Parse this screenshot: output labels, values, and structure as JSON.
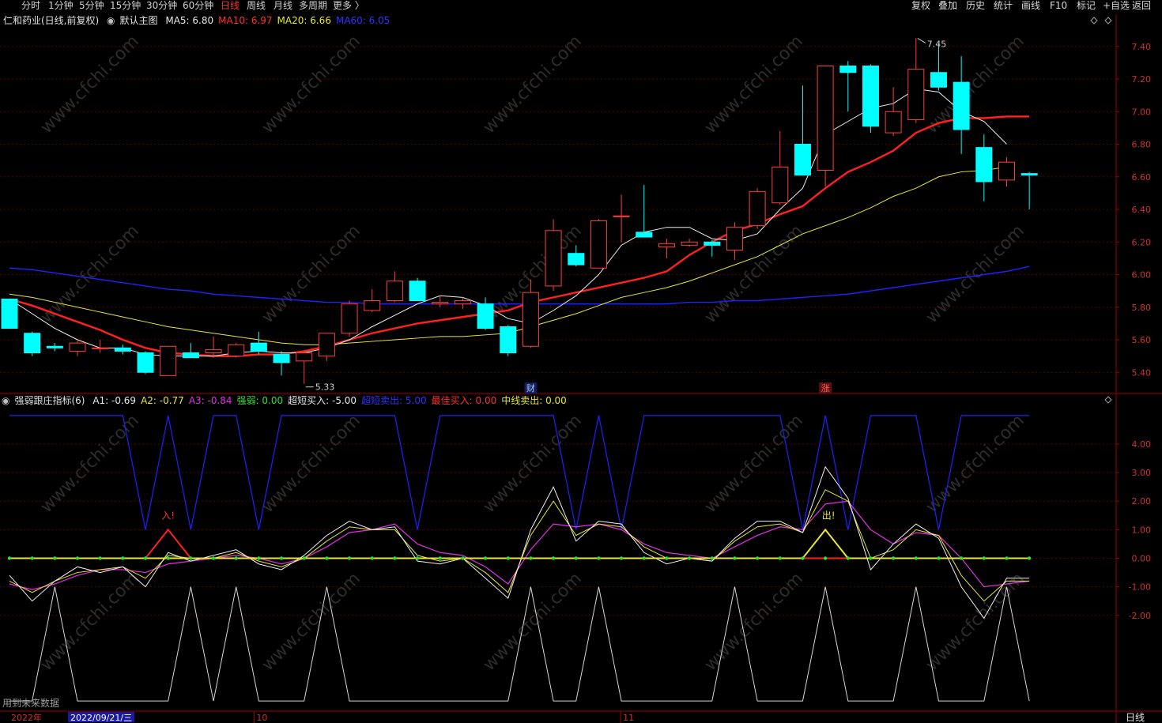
{
  "toolbar": {
    "tabs": [
      "分时",
      "1分钟",
      "5分钟",
      "15分钟",
      "30分钟",
      "60分钟",
      "日线",
      "周线",
      "月线",
      "多周期",
      "更多 〉"
    ],
    "active_tab": "日线",
    "right": [
      "复权",
      "叠加",
      "历史",
      "统计",
      "画线",
      "F10",
      "标记",
      "+自选",
      "返回"
    ]
  },
  "main_legend": {
    "stock": "仁和药业(日线,前复权)",
    "template": "默认主图",
    "items": [
      {
        "label": "MA5:",
        "value": "6.80",
        "color": "#e8e8e8"
      },
      {
        "label": "MA10:",
        "value": "6.97",
        "color": "#ff3030"
      },
      {
        "label": "MA20:",
        "value": "6.66",
        "color": "#e8e830"
      },
      {
        "label": "MA60:",
        "value": "6.05",
        "color": "#3030ff"
      }
    ]
  },
  "sub_legend": {
    "name": "强弱跟庄指标(6)",
    "items": [
      {
        "label": "A1:",
        "value": "-0.69",
        "color": "#e8e8e8"
      },
      {
        "label": "A2:",
        "value": "-0.77",
        "color": "#e8e830"
      },
      {
        "label": "A3:",
        "value": "-0.84",
        "color": "#e030e0"
      },
      {
        "label": "强弱:",
        "value": "0.00",
        "color": "#30e030"
      },
      {
        "label": "超短买入:",
        "value": "-5.00",
        "color": "#e8e8e8"
      },
      {
        "label": "超短卖出:",
        "value": "5.00",
        "color": "#3030ff"
      },
      {
        "label": "最佳买入:",
        "value": "0.00",
        "color": "#ff3030"
      },
      {
        "label": "中线卖出:",
        "value": "0.00",
        "color": "#e8e830"
      }
    ]
  },
  "colors": {
    "up": "#ff3d3d",
    "down": "#00ffff",
    "ma5": "#f0f0f0",
    "ma10": "#ff2020",
    "ma20": "#e8e830",
    "ma60": "#2020ff",
    "grid": "#5a0000",
    "border": "#a00000"
  },
  "annotations": {
    "high": "7.45",
    "low": "5.33",
    "cai_marker": "财",
    "zhang_marker": "涨",
    "buy_marker": "入!",
    "sell_marker": "出!",
    "watermark": "www.cfchi.com",
    "footer_note": "用到未来数据"
  },
  "bottom_axis": {
    "labels": [
      "2022年",
      "10",
      "11"
    ],
    "cursor_date": "2022/09/21/三",
    "period_label": "日线"
  },
  "chart_data": [
    {
      "type": "candlestick",
      "title": "仁和药业(日线,前复权)",
      "ylim": [
        5.28,
        7.52
      ],
      "yticks": [
        5.4,
        5.6,
        5.8,
        6.0,
        6.2,
        6.4,
        6.6,
        6.8,
        7.0,
        7.2,
        7.4
      ],
      "candles": [
        [
          5.85,
          5.82,
          5.67,
          5.67
        ],
        [
          5.64,
          5.65,
          5.5,
          5.52
        ],
        [
          5.56,
          5.58,
          5.53,
          5.55
        ],
        [
          5.53,
          5.6,
          5.5,
          5.58
        ],
        [
          5.55,
          5.6,
          5.52,
          5.55
        ],
        [
          5.55,
          5.57,
          5.51,
          5.53
        ],
        [
          5.52,
          5.53,
          5.39,
          5.4
        ],
        [
          5.38,
          5.56,
          5.38,
          5.56
        ],
        [
          5.52,
          5.58,
          5.5,
          5.49
        ],
        [
          5.52,
          5.62,
          5.49,
          5.54
        ],
        [
          5.5,
          5.58,
          5.49,
          5.57
        ],
        [
          5.58,
          5.65,
          5.51,
          5.53
        ],
        [
          5.51,
          5.53,
          5.38,
          5.46
        ],
        [
          5.47,
          5.53,
          5.33,
          5.52
        ],
        [
          5.5,
          5.64,
          5.47,
          5.64
        ],
        [
          5.64,
          5.84,
          5.62,
          5.82
        ],
        [
          5.78,
          5.91,
          5.77,
          5.84
        ],
        [
          5.84,
          6.02,
          5.83,
          5.96
        ],
        [
          5.96,
          5.98,
          5.84,
          5.84
        ],
        [
          5.82,
          5.87,
          5.8,
          5.83
        ],
        [
          5.82,
          5.86,
          5.79,
          5.84
        ],
        [
          5.82,
          5.86,
          5.66,
          5.67
        ],
        [
          5.68,
          5.69,
          5.5,
          5.52
        ],
        [
          5.56,
          5.97,
          5.55,
          5.89
        ],
        [
          5.93,
          6.34,
          5.9,
          6.27
        ],
        [
          6.13,
          6.18,
          6.05,
          6.06
        ],
        [
          6.04,
          6.34,
          6.04,
          6.33
        ],
        [
          6.36,
          6.49,
          6.2,
          6.36
        ],
        [
          6.26,
          6.55,
          6.25,
          6.23
        ],
        [
          6.17,
          6.22,
          6.1,
          6.19
        ],
        [
          6.18,
          6.22,
          6.17,
          6.2
        ],
        [
          6.2,
          6.21,
          6.11,
          6.18
        ],
        [
          6.15,
          6.32,
          6.09,
          6.29
        ],
        [
          6.3,
          6.53,
          6.28,
          6.51
        ],
        [
          6.44,
          6.88,
          6.43,
          6.66
        ],
        [
          6.8,
          7.16,
          6.62,
          6.61
        ],
        [
          6.64,
          7.28,
          6.54,
          7.28
        ],
        [
          7.28,
          7.31,
          7.0,
          7.24
        ],
        [
          7.28,
          7.29,
          6.87,
          6.91
        ],
        [
          6.87,
          7.15,
          6.85,
          7.0
        ],
        [
          6.95,
          7.45,
          6.93,
          7.26
        ],
        [
          7.24,
          7.42,
          7.13,
          7.15
        ],
        [
          7.18,
          7.34,
          6.74,
          6.89
        ],
        [
          6.78,
          6.86,
          6.45,
          6.57
        ],
        [
          6.58,
          6.72,
          6.54,
          6.69
        ],
        [
          6.62,
          6.63,
          6.4,
          6.61
        ]
      ],
      "ma5": [
        5.85,
        5.76,
        5.67,
        5.6,
        5.55,
        5.55,
        5.51,
        5.5,
        5.5,
        5.5,
        5.52,
        5.53,
        5.52,
        5.52,
        5.55,
        5.6,
        5.68,
        5.75,
        5.82,
        5.87,
        5.86,
        5.81,
        5.73,
        5.7,
        5.78,
        5.87,
        6.0,
        6.18,
        6.26,
        6.29,
        6.29,
        6.22,
        6.21,
        6.25,
        6.4,
        6.53,
        6.86,
        6.94,
        7.02,
        7.05,
        7.14,
        7.12,
        7.0,
        6.94,
        6.8
      ],
      "ma10": [
        5.85,
        5.81,
        5.76,
        5.71,
        5.66,
        5.6,
        5.55,
        5.52,
        5.51,
        5.5,
        5.5,
        5.51,
        5.51,
        5.53,
        5.56,
        5.6,
        5.64,
        5.67,
        5.7,
        5.72,
        5.74,
        5.76,
        5.78,
        5.83,
        5.86,
        5.89,
        5.92,
        5.95,
        5.98,
        6.02,
        6.12,
        6.2,
        6.27,
        6.31,
        6.37,
        6.42,
        6.53,
        6.63,
        6.69,
        6.76,
        6.87,
        6.93,
        6.96,
        6.96,
        6.97,
        6.97
      ],
      "ma20": [
        5.88,
        5.86,
        5.83,
        5.8,
        5.77,
        5.74,
        5.71,
        5.68,
        5.66,
        5.64,
        5.62,
        5.6,
        5.58,
        5.57,
        5.57,
        5.58,
        5.59,
        5.6,
        5.61,
        5.62,
        5.62,
        5.63,
        5.64,
        5.68,
        5.72,
        5.76,
        5.81,
        5.86,
        5.89,
        5.92,
        5.96,
        6.01,
        6.06,
        6.11,
        6.18,
        6.25,
        6.3,
        6.35,
        6.41,
        6.48,
        6.53,
        6.6,
        6.63,
        6.64,
        6.66
      ],
      "ma60": [
        6.04,
        6.03,
        6.01,
        5.99,
        5.97,
        5.95,
        5.93,
        5.91,
        5.9,
        5.88,
        5.87,
        5.86,
        5.85,
        5.84,
        5.83,
        5.83,
        5.82,
        5.82,
        5.82,
        5.82,
        5.82,
        5.82,
        5.82,
        5.82,
        5.82,
        5.82,
        5.82,
        5.82,
        5.82,
        5.82,
        5.83,
        5.83,
        5.84,
        5.84,
        5.85,
        5.86,
        5.87,
        5.88,
        5.9,
        5.92,
        5.94,
        5.96,
        5.98,
        6.0,
        6.02,
        6.05
      ]
    },
    {
      "type": "line",
      "title": "强弱跟庄指标(6)",
      "ylim": [
        -5.3,
        5.3
      ],
      "yticks": [
        -2.0,
        -1.0,
        0.0,
        1.0,
        2.0,
        3.0,
        4.0
      ],
      "series": [
        {
          "name": "A1",
          "values": [
            -0.6,
            -1.5,
            -0.8,
            -0.3,
            -0.5,
            -0.3,
            -1.0,
            0.2,
            -0.1,
            0.1,
            0.3,
            -0.2,
            -0.4,
            0.1,
            0.8,
            1.3,
            1.0,
            1.1,
            -0.1,
            -0.2,
            0.0,
            -0.7,
            -1.4,
            1.0,
            2.5,
            0.6,
            1.3,
            1.2,
            0.2,
            -0.2,
            0.0,
            -0.1,
            0.7,
            1.3,
            1.3,
            0.9,
            3.2,
            2.1,
            -0.4,
            0.5,
            1.2,
            0.7,
            -1.0,
            -2.1,
            -0.7,
            -0.7
          ]
        },
        {
          "name": "A2",
          "values": [
            -0.8,
            -1.2,
            -0.8,
            -0.5,
            -0.4,
            -0.3,
            -0.7,
            0.1,
            0.0,
            0.0,
            0.2,
            -0.1,
            -0.3,
            0.0,
            0.6,
            1.1,
            1.0,
            1.0,
            0.1,
            -0.1,
            0.0,
            -0.5,
            -1.2,
            0.8,
            2.0,
            0.8,
            1.2,
            1.1,
            0.4,
            0.0,
            0.0,
            -0.1,
            0.6,
            1.1,
            1.2,
            0.9,
            2.4,
            2.0,
            0.0,
            0.3,
            1.0,
            0.8,
            -0.6,
            -1.5,
            -0.8,
            -0.8
          ]
        },
        {
          "name": "A3",
          "values": [
            -0.9,
            -1.1,
            -0.9,
            -0.6,
            -0.4,
            -0.4,
            -0.5,
            -0.2,
            -0.1,
            0.0,
            0.1,
            0.0,
            -0.2,
            0.0,
            0.4,
            0.9,
            1.0,
            1.2,
            0.5,
            0.2,
            0.1,
            -0.3,
            -0.9,
            0.3,
            1.2,
            1.1,
            1.2,
            1.0,
            0.5,
            0.2,
            0.1,
            0.0,
            0.4,
            0.8,
            1.1,
            1.0,
            1.9,
            2.0,
            1.0,
            0.5,
            0.9,
            0.8,
            0.0,
            -1.0,
            -0.9,
            -0.8
          ]
        },
        {
          "name": "超短买入",
          "values": [
            -5,
            -5,
            -1,
            -5,
            -5,
            -5,
            -5,
            -5,
            -1,
            -5,
            -1,
            -5,
            -5,
            -5,
            -1,
            -5,
            -5,
            -5,
            -5,
            -5,
            -5,
            -5,
            -5,
            -1,
            -5,
            -5,
            -1,
            -5,
            -5,
            -5,
            -5,
            -5,
            -1,
            -5,
            -5,
            -5,
            -1,
            -5,
            -5,
            -5,
            -1,
            -5,
            -5,
            -5,
            -1,
            -5
          ]
        },
        {
          "name": "超短卖出",
          "values": [
            5,
            5,
            5,
            5,
            5,
            5,
            1,
            5,
            1,
            5,
            5,
            1,
            5,
            5,
            5,
            5,
            5,
            5,
            1,
            5,
            5,
            5,
            5,
            5,
            5,
            1,
            5,
            1,
            5,
            5,
            5,
            5,
            5,
            5,
            5,
            1,
            5,
            1,
            5,
            5,
            5,
            1,
            5,
            5,
            5,
            5
          ]
        },
        {
          "name": "最佳买入",
          "values": [
            0,
            0,
            0,
            0,
            0,
            0,
            0,
            1,
            0,
            0,
            0,
            0,
            0,
            0,
            0,
            0,
            0,
            0,
            0,
            0,
            0,
            0,
            0,
            0,
            0,
            0,
            0,
            0,
            0,
            0,
            0,
            0,
            0,
            0,
            0,
            0,
            0,
            0,
            0,
            0,
            0,
            0,
            0,
            0,
            0,
            0
          ]
        },
        {
          "name": "中线卖出",
          "values": [
            0,
            0,
            0,
            0,
            0,
            0,
            0,
            0,
            0,
            0,
            0,
            0,
            0,
            0,
            0,
            0,
            0,
            0,
            0,
            0,
            0,
            0,
            0,
            0,
            0,
            0,
            0,
            0,
            0,
            0,
            0,
            0,
            0,
            0,
            0,
            0,
            1,
            0,
            0,
            0,
            0,
            0,
            0,
            0,
            0,
            0
          ]
        },
        {
          "name": "强弱",
          "values": [
            0,
            0,
            0,
            0,
            0,
            0,
            0,
            0,
            0,
            0,
            0,
            0,
            0,
            0,
            0,
            0,
            0,
            0,
            0,
            0,
            0,
            0,
            0,
            0,
            0,
            0,
            0,
            0,
            0,
            0,
            0,
            0,
            0,
            0,
            0,
            0,
            0,
            0,
            0,
            0,
            0,
            0,
            0,
            0,
            0,
            0
          ]
        }
      ]
    }
  ]
}
